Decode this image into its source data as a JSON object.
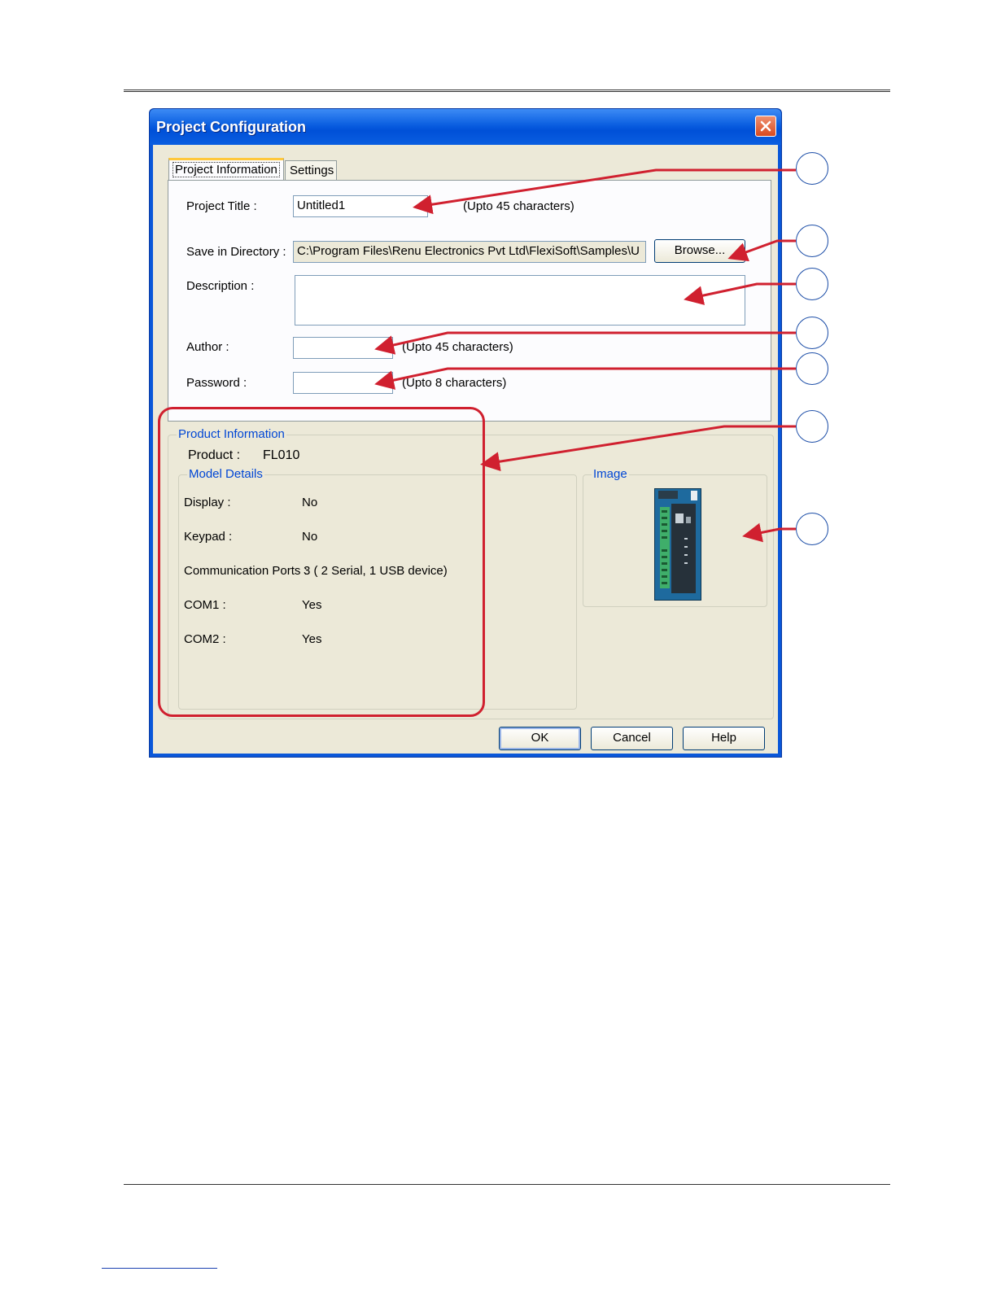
{
  "dialog": {
    "title": "Project Configuration",
    "tabs": [
      {
        "label": "Project Information",
        "active": true
      },
      {
        "label": "Settings",
        "active": false
      }
    ],
    "fields": {
      "project_title_label": "Project Title :",
      "project_title_value": "Untitled1",
      "project_title_hint": "(Upto 45 characters)",
      "save_dir_label": "Save in Directory :",
      "save_dir_value": "C:\\Program Files\\Renu Electronics Pvt Ltd\\FlexiSoft\\Samples\\U",
      "browse_label": "Browse...",
      "description_label": "Description :",
      "description_value": "",
      "author_label": "Author :",
      "author_value": "",
      "author_hint": "(Upto 45 characters)",
      "password_label": "Password :",
      "password_value": "",
      "password_hint": "(Upto 8 characters)"
    },
    "product_info": {
      "legend": "Product Information",
      "product_label": "Product :",
      "product_value": "FL010",
      "model_details_legend": "Model Details",
      "details": [
        {
          "label": "Display :",
          "value": "No"
        },
        {
          "label": "Keypad :",
          "value": "No"
        },
        {
          "label": "Communication Ports :",
          "value": "3 ( 2 Serial, 1 USB device)"
        },
        {
          "label": "COM1 :",
          "value": "Yes"
        },
        {
          "label": "COM2 :",
          "value": "Yes"
        }
      ],
      "image_legend": "Image"
    },
    "buttons": {
      "ok": "OK",
      "cancel": "Cancel",
      "help": "Help"
    }
  },
  "colors": {
    "titlebar": "#0a5ee0",
    "dialog_bg": "#ece9d8",
    "annotation_red": "#d0202f",
    "legend_blue": "#0046d5"
  }
}
